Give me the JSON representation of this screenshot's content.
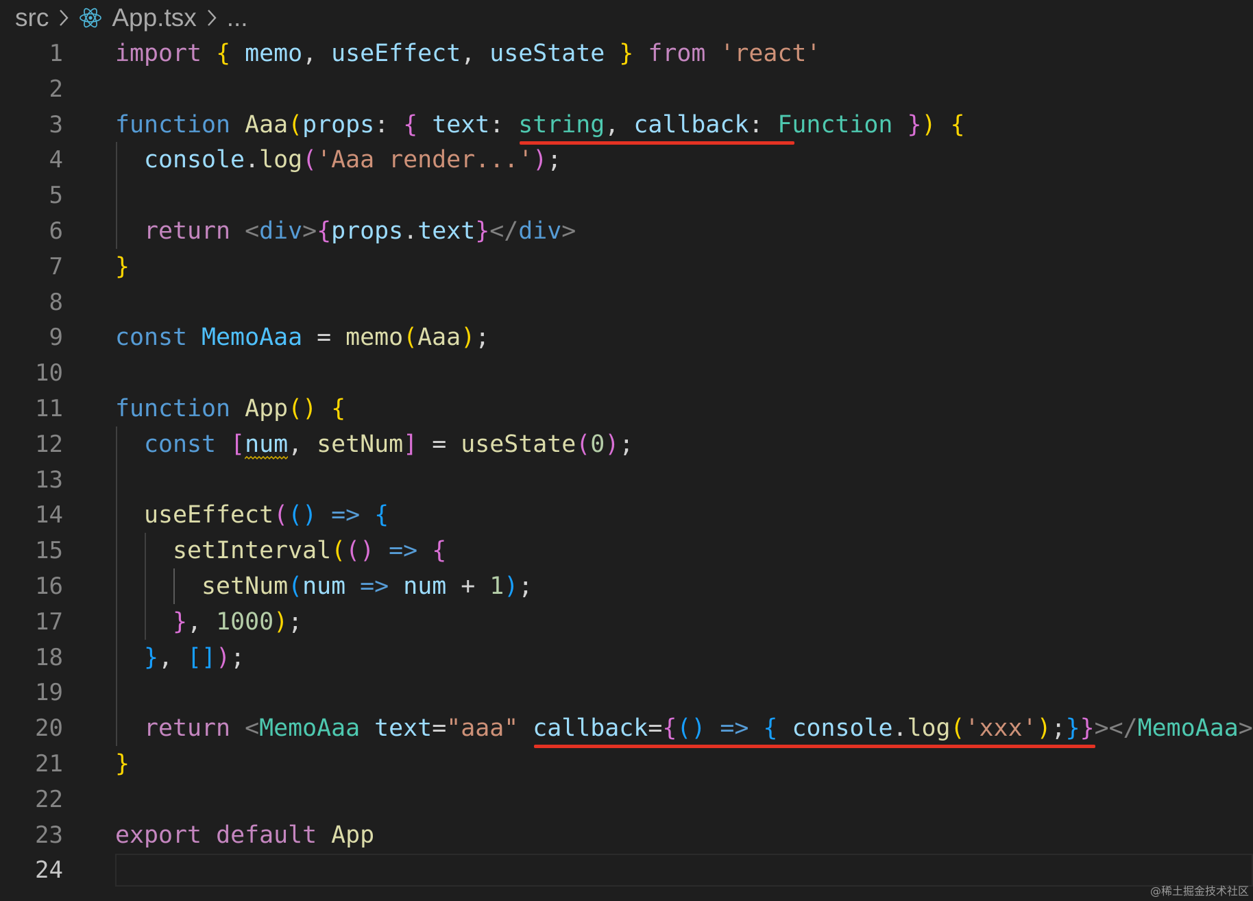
{
  "breadcrumb": {
    "folder": "src",
    "file": "App.tsx",
    "ellipsis": "..."
  },
  "editor": {
    "active_line": 24,
    "lines": [
      {
        "num": "1",
        "tokens": [
          [
            "kw-ctrl",
            "import"
          ],
          [
            "punc",
            " "
          ],
          [
            "br1",
            "{"
          ],
          [
            "punc",
            " "
          ],
          [
            "var",
            "memo"
          ],
          [
            "punc",
            ", "
          ],
          [
            "var",
            "useEffect"
          ],
          [
            "punc",
            ", "
          ],
          [
            "var",
            "useState"
          ],
          [
            "punc",
            " "
          ],
          [
            "br1",
            "}"
          ],
          [
            "punc",
            " "
          ],
          [
            "kw-ctrl",
            "from"
          ],
          [
            "punc",
            " "
          ],
          [
            "str",
            "'react'"
          ]
        ]
      },
      {
        "num": "2",
        "tokens": []
      },
      {
        "num": "3",
        "tokens": [
          [
            "kw",
            "function"
          ],
          [
            "punc",
            " "
          ],
          [
            "fn",
            "Aaa"
          ],
          [
            "br1",
            "("
          ],
          [
            "var",
            "props"
          ],
          [
            "punc",
            ": "
          ],
          [
            "br2",
            "{"
          ],
          [
            "punc",
            " "
          ],
          [
            "var",
            "text"
          ],
          [
            "punc",
            ": "
          ],
          [
            "type",
            "string"
          ],
          [
            "punc",
            ", "
          ],
          [
            "var",
            "callback"
          ],
          [
            "punc",
            ": "
          ],
          [
            "type",
            "Function"
          ],
          [
            "punc",
            " "
          ],
          [
            "br2",
            "}"
          ],
          [
            "br1",
            ")"
          ],
          [
            "punc",
            " "
          ],
          [
            "br1",
            "{"
          ]
        ]
      },
      {
        "num": "4",
        "tokens": [
          [
            "punc",
            "  "
          ],
          [
            "var",
            "console"
          ],
          [
            "punc",
            "."
          ],
          [
            "fn",
            "log"
          ],
          [
            "br2",
            "("
          ],
          [
            "str",
            "'Aaa render...'"
          ],
          [
            "br2",
            ")"
          ],
          [
            "punc",
            ";"
          ]
        ]
      },
      {
        "num": "5",
        "tokens": []
      },
      {
        "num": "6",
        "tokens": [
          [
            "punc",
            "  "
          ],
          [
            "kw-ctrl",
            "return"
          ],
          [
            "punc",
            " "
          ],
          [
            "angle",
            "<"
          ],
          [
            "tag",
            "div"
          ],
          [
            "angle",
            ">"
          ],
          [
            "br2",
            "{"
          ],
          [
            "var",
            "props"
          ],
          [
            "punc",
            "."
          ],
          [
            "var",
            "text"
          ],
          [
            "br2",
            "}"
          ],
          [
            "angle",
            "</"
          ],
          [
            "tag",
            "div"
          ],
          [
            "angle",
            ">"
          ]
        ]
      },
      {
        "num": "7",
        "tokens": [
          [
            "br1",
            "}"
          ]
        ]
      },
      {
        "num": "8",
        "tokens": []
      },
      {
        "num": "9",
        "tokens": [
          [
            "kw",
            "const"
          ],
          [
            "punc",
            " "
          ],
          [
            "cnst",
            "MemoAaa"
          ],
          [
            "punc",
            " = "
          ],
          [
            "fn",
            "memo"
          ],
          [
            "br1",
            "("
          ],
          [
            "fn",
            "Aaa"
          ],
          [
            "br1",
            ")"
          ],
          [
            "punc",
            ";"
          ]
        ]
      },
      {
        "num": "10",
        "tokens": []
      },
      {
        "num": "11",
        "tokens": [
          [
            "kw",
            "function"
          ],
          [
            "punc",
            " "
          ],
          [
            "fn",
            "App"
          ],
          [
            "br1",
            "()"
          ],
          [
            "punc",
            " "
          ],
          [
            "br1",
            "{"
          ]
        ]
      },
      {
        "num": "12",
        "tokens": [
          [
            "punc",
            "  "
          ],
          [
            "kw",
            "const"
          ],
          [
            "punc",
            " "
          ],
          [
            "br2",
            "["
          ],
          [
            "var",
            "num"
          ],
          [
            "punc",
            ", "
          ],
          [
            "fn",
            "setNum"
          ],
          [
            "br2",
            "]"
          ],
          [
            "punc",
            " = "
          ],
          [
            "fn",
            "useState"
          ],
          [
            "br2",
            "("
          ],
          [
            "num",
            "0"
          ],
          [
            "br2",
            ")"
          ],
          [
            "punc",
            ";"
          ]
        ]
      },
      {
        "num": "13",
        "tokens": []
      },
      {
        "num": "14",
        "tokens": [
          [
            "punc",
            "  "
          ],
          [
            "fn",
            "useEffect"
          ],
          [
            "br2",
            "("
          ],
          [
            "br3",
            "()"
          ],
          [
            "punc",
            " "
          ],
          [
            "kw",
            "=>"
          ],
          [
            "punc",
            " "
          ],
          [
            "br3",
            "{"
          ]
        ]
      },
      {
        "num": "15",
        "tokens": [
          [
            "punc",
            "    "
          ],
          [
            "fn",
            "setInterval"
          ],
          [
            "br1",
            "("
          ],
          [
            "br2",
            "()"
          ],
          [
            "punc",
            " "
          ],
          [
            "kw",
            "=>"
          ],
          [
            "punc",
            " "
          ],
          [
            "br2",
            "{"
          ]
        ]
      },
      {
        "num": "16",
        "tokens": [
          [
            "punc",
            "      "
          ],
          [
            "fn",
            "setNum"
          ],
          [
            "br3",
            "("
          ],
          [
            "var",
            "num"
          ],
          [
            "punc",
            " "
          ],
          [
            "kw",
            "=>"
          ],
          [
            "punc",
            " "
          ],
          [
            "var",
            "num"
          ],
          [
            "punc",
            " + "
          ],
          [
            "num",
            "1"
          ],
          [
            "br3",
            ")"
          ],
          [
            "punc",
            ";"
          ]
        ]
      },
      {
        "num": "17",
        "tokens": [
          [
            "punc",
            "    "
          ],
          [
            "br2",
            "}"
          ],
          [
            "punc",
            ", "
          ],
          [
            "num",
            "1000"
          ],
          [
            "br1",
            ")"
          ],
          [
            "punc",
            ";"
          ]
        ]
      },
      {
        "num": "18",
        "tokens": [
          [
            "punc",
            "  "
          ],
          [
            "br3",
            "}"
          ],
          [
            "punc",
            ", "
          ],
          [
            "br3",
            "[]"
          ],
          [
            "br2",
            ")"
          ],
          [
            "punc",
            ";"
          ]
        ]
      },
      {
        "num": "19",
        "tokens": []
      },
      {
        "num": "20",
        "tokens": [
          [
            "punc",
            "  "
          ],
          [
            "kw-ctrl",
            "return"
          ],
          [
            "punc",
            " "
          ],
          [
            "angle",
            "<"
          ],
          [
            "comp",
            "MemoAaa"
          ],
          [
            "punc",
            " "
          ],
          [
            "var",
            "text"
          ],
          [
            "punc",
            "="
          ],
          [
            "str",
            "\"aaa\""
          ],
          [
            "punc",
            " "
          ],
          [
            "var",
            "callback"
          ],
          [
            "punc",
            "="
          ],
          [
            "br2",
            "{"
          ],
          [
            "br3",
            "()"
          ],
          [
            "punc",
            " "
          ],
          [
            "kw",
            "=>"
          ],
          [
            "punc",
            " "
          ],
          [
            "br3",
            "{"
          ],
          [
            "punc",
            " "
          ],
          [
            "var",
            "console"
          ],
          [
            "punc",
            "."
          ],
          [
            "fn",
            "log"
          ],
          [
            "br1",
            "("
          ],
          [
            "str",
            "'xxx'"
          ],
          [
            "br1",
            ")"
          ],
          [
            "punc",
            ";"
          ],
          [
            "br3",
            "}"
          ],
          [
            "br2",
            "}"
          ],
          [
            "angle",
            "></"
          ],
          [
            "comp",
            "MemoAaa"
          ],
          [
            "angle",
            ">"
          ]
        ]
      },
      {
        "num": "21",
        "tokens": [
          [
            "br1",
            "}"
          ]
        ]
      },
      {
        "num": "22",
        "tokens": []
      },
      {
        "num": "23",
        "tokens": [
          [
            "kw-ctrl",
            "export"
          ],
          [
            "punc",
            " "
          ],
          [
            "kw-ctrl",
            "default"
          ],
          [
            "punc",
            " "
          ],
          [
            "fn",
            "App"
          ]
        ]
      },
      {
        "num": "24",
        "tokens": []
      }
    ]
  },
  "watermark": "@稀土掘金技术社区",
  "colors": {
    "background": "#1e1e1e",
    "annotation_underline": "#e53223"
  }
}
